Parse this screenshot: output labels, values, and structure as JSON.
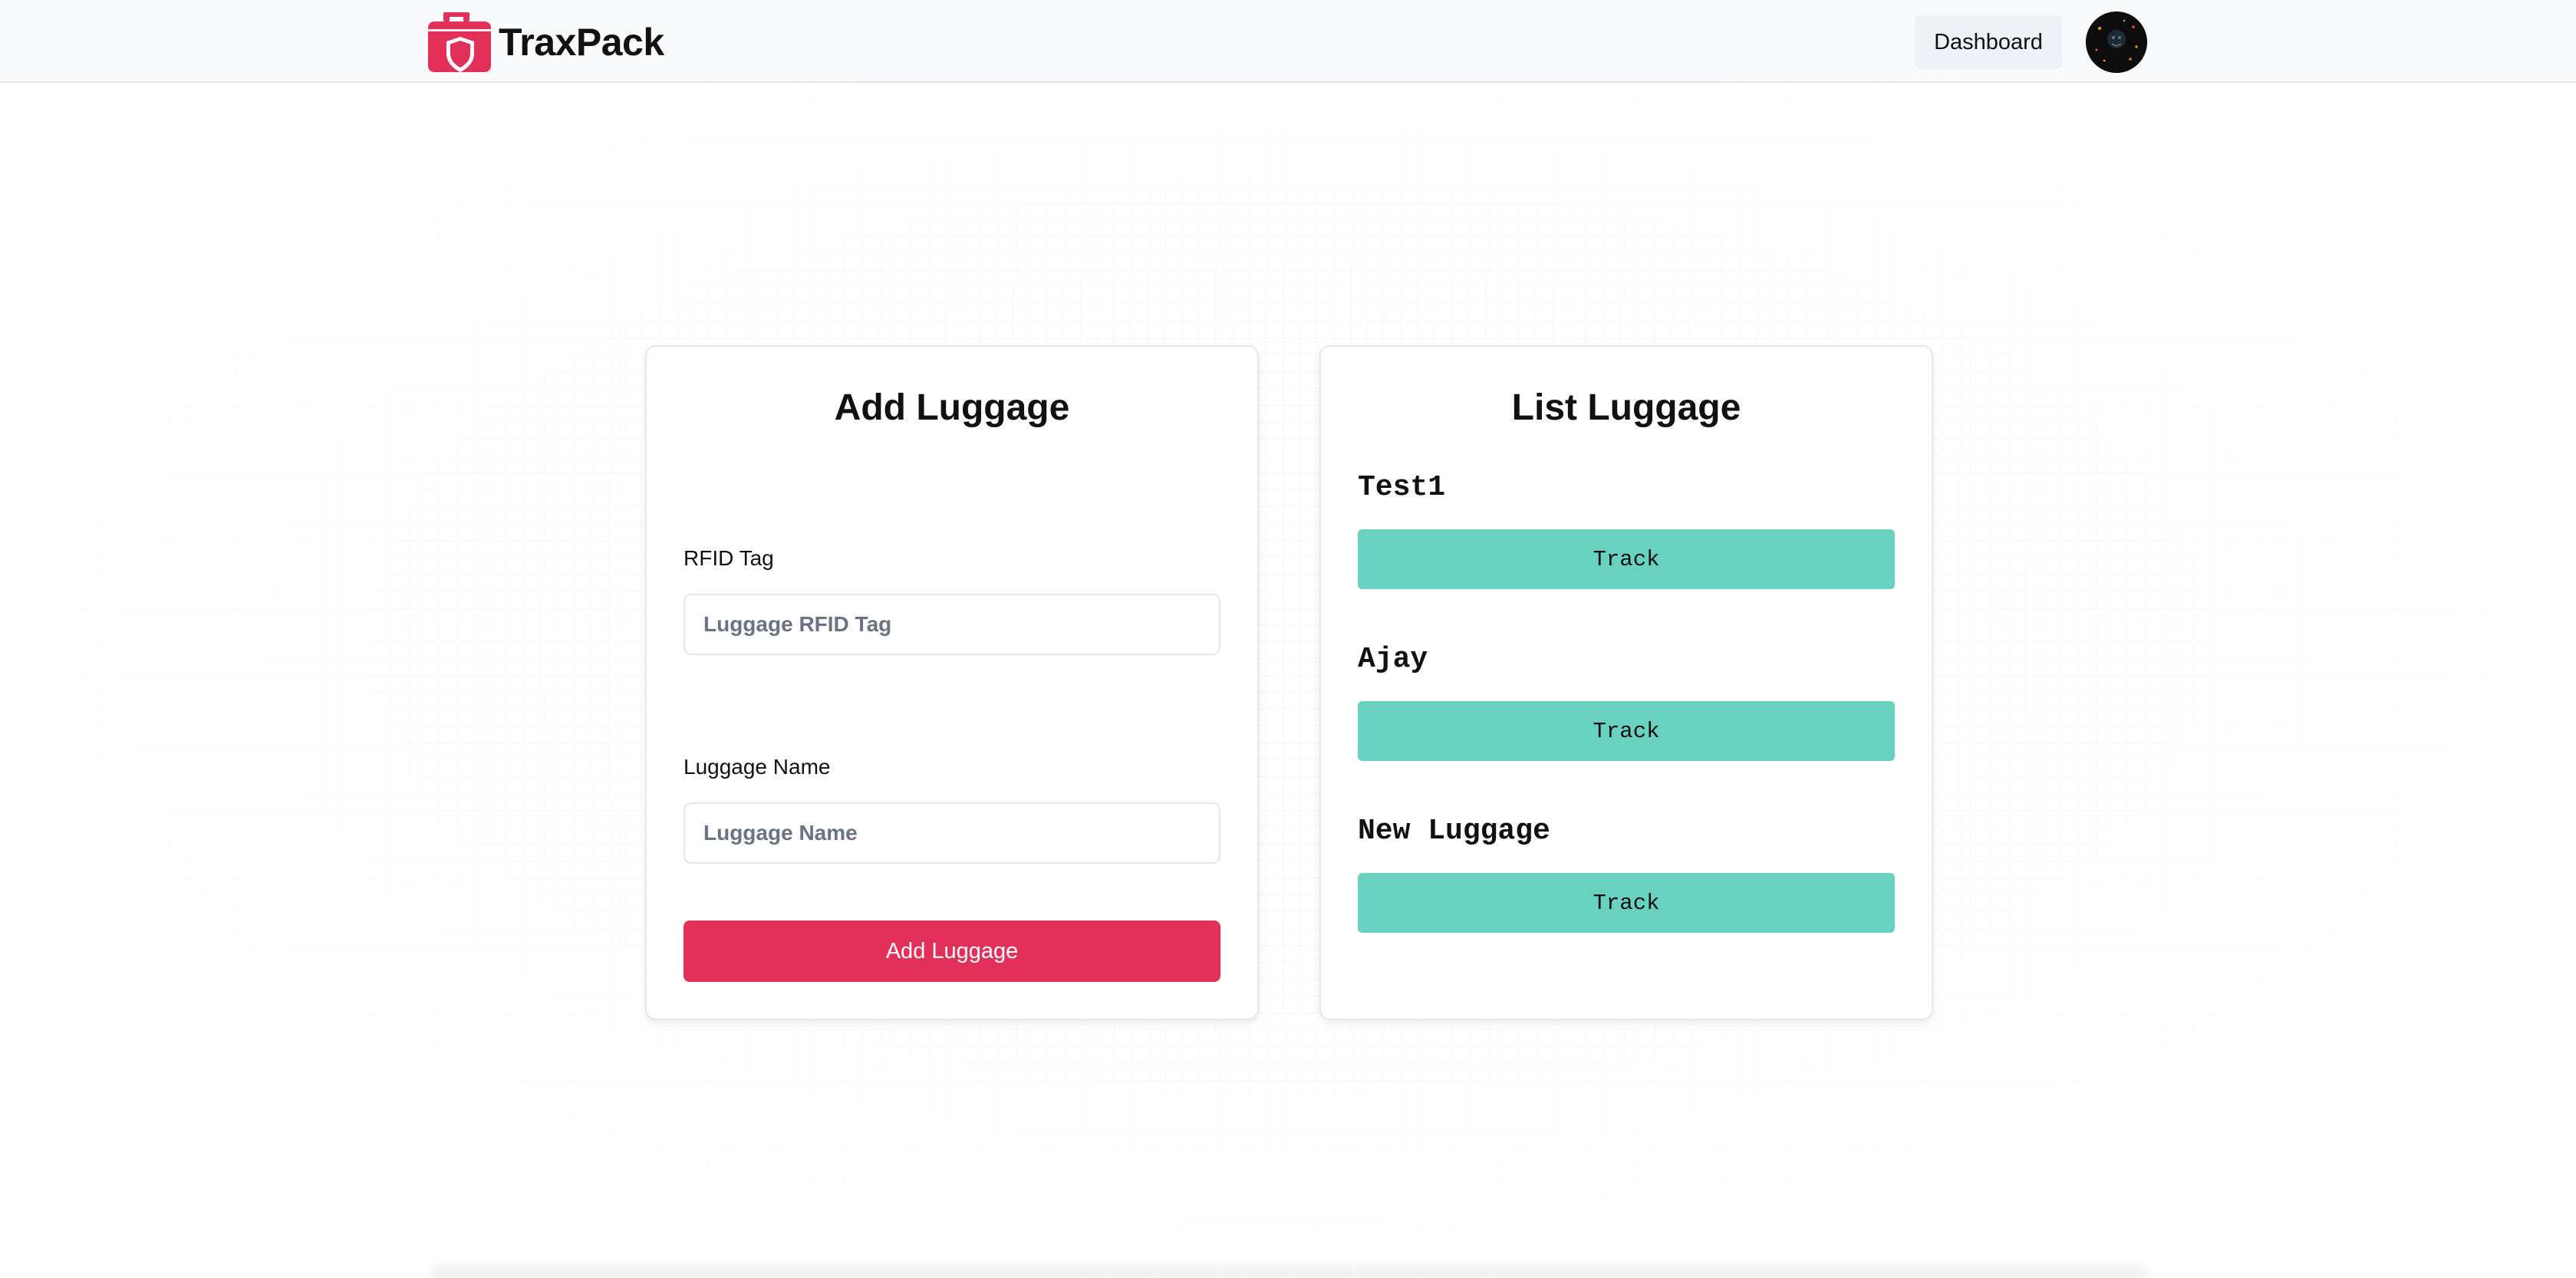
{
  "header": {
    "brand_name": "TraxPack",
    "nav_dashboard": "Dashboard",
    "brand_color": "#e3305b"
  },
  "add_luggage": {
    "title": "Add Luggage",
    "rfid_label": "RFID Tag",
    "rfid_placeholder": "Luggage RFID Tag",
    "rfid_value": "",
    "name_label": "Luggage Name",
    "name_placeholder": "Luggage Name",
    "name_value": "",
    "submit_label": "Add Luggage",
    "submit_color": "#e3305b"
  },
  "list_luggage": {
    "title": "List Luggage",
    "track_color": "#69d1c0",
    "items": [
      {
        "name": "Test1",
        "action_label": "Track"
      },
      {
        "name": "Ajay",
        "action_label": "Track"
      },
      {
        "name": "New Luggage",
        "action_label": "Track"
      }
    ]
  },
  "icons": {
    "brand": "luggage-shield-icon",
    "avatar": "user-avatar-icon"
  }
}
